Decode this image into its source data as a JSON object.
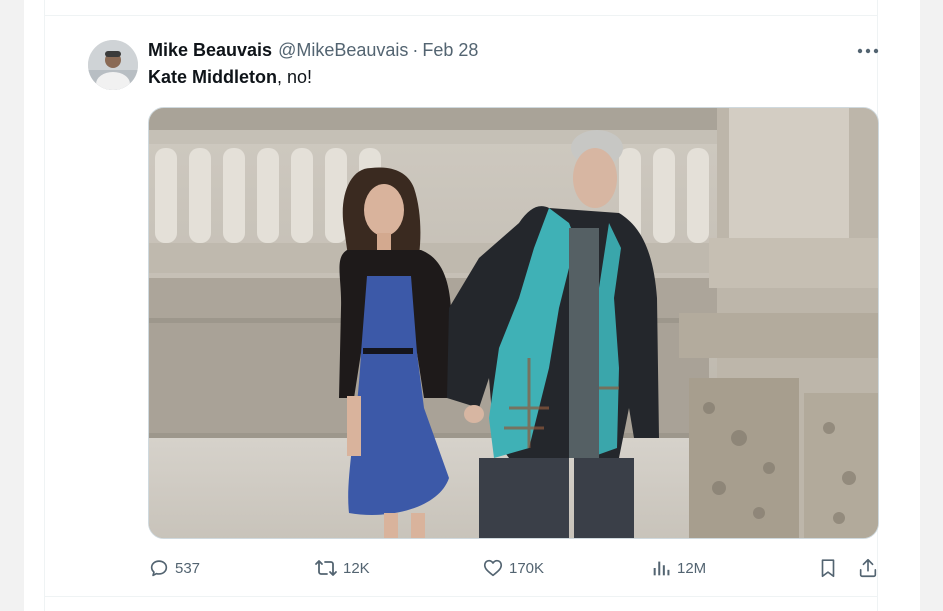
{
  "tweet": {
    "display_name": "Mike Beauvais",
    "handle": "@MikeBeauvais",
    "separator": "·",
    "date": "Feb 28",
    "text_mention": "Kate Middleton",
    "text_rest": ", no!"
  },
  "actions": {
    "replies": "537",
    "reposts": "12K",
    "likes": "170K",
    "views": "12M"
  },
  "colors": {
    "text_primary": "#0f1419",
    "text_secondary": "#536471",
    "border": "#eff3f4"
  },
  "icons": [
    "more-icon",
    "reply-icon",
    "repost-icon",
    "like-icon",
    "views-icon",
    "bookmark-icon",
    "share-icon"
  ]
}
